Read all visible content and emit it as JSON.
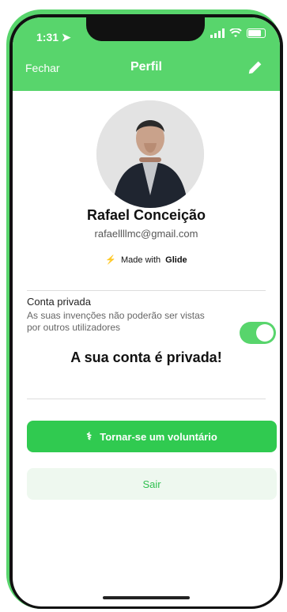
{
  "status_bar": {
    "time": "1:31"
  },
  "header": {
    "close_label": "Fechar",
    "title": "Perfil",
    "edit_icon": "pencil-icon"
  },
  "profile": {
    "name": "Rafael Conceição",
    "email": "rafaellllmc@gmail.com",
    "badge": "Made with",
    "badge_brand": "Glide"
  },
  "privacy": {
    "title": "Conta privada",
    "description": "As suas invenções não poderão ser vistas por outros utilizadores",
    "enabled": true,
    "status_text": "A sua conta é privada!"
  },
  "actions": {
    "volunteer_label": "Tornar-se um voluntário",
    "logout_label": "Sair"
  },
  "colors": {
    "primary": "#58d56c",
    "button": "#30ca50",
    "secondary_bg": "#eef8ef"
  }
}
